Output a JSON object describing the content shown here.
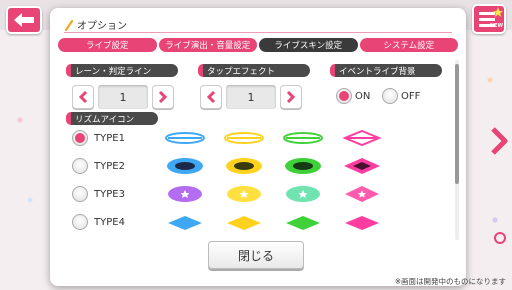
{
  "dialog": {
    "title": "オプション",
    "close_label": "閉じる"
  },
  "tabs": [
    {
      "label": "ライブ設定",
      "active": false
    },
    {
      "label": "ライブ演出・音量設定",
      "active": false
    },
    {
      "label": "ライブスキン設定",
      "active": true
    },
    {
      "label": "システム設定",
      "active": false
    }
  ],
  "lane": {
    "label": "レーン・判定ライン",
    "value": "1"
  },
  "tap_effect": {
    "label": "タップエフェクト",
    "value": "1"
  },
  "event_bg": {
    "label": "イベントライブ背景",
    "on_label": "ON",
    "off_label": "OFF",
    "selected": "ON"
  },
  "rhythm": {
    "label": "リズムアイコン",
    "types": [
      {
        "label": "TYPE1",
        "selected": true
      },
      {
        "label": "TYPE2",
        "selected": false
      },
      {
        "label": "TYPE3",
        "selected": false
      },
      {
        "label": "TYPE4",
        "selected": false
      }
    ]
  },
  "note_colors": [
    "#3fa8f4",
    "#ffd21f",
    "#3ed13a",
    "#ff3ca0"
  ],
  "footnote": "※画面は開発中のものになります",
  "colors": {
    "accent": "#e84476",
    "active_tab": "#3a3a3a",
    "label_bg": "#4a4a4a"
  }
}
